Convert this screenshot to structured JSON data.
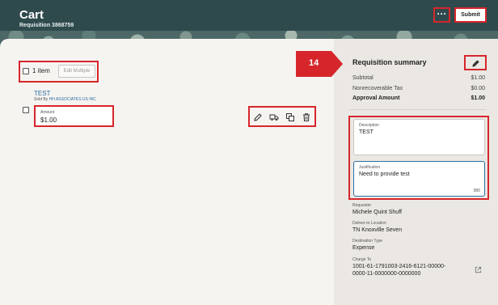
{
  "header": {
    "title": "Cart",
    "requisition": "Requisition 3868759",
    "more_label": "···",
    "submit_label": "Submit"
  },
  "selection": {
    "item_count": "1 item",
    "edit_multiple_label": "Edit Multiple"
  },
  "line_item": {
    "name": "TEST",
    "sold_by_prefix": "Sold By",
    "supplier": "HH ASSOCIATES US INC",
    "amount_label": "Amount",
    "amount_value": "$1.00",
    "actions": [
      "edit-icon",
      "truck-icon",
      "copy-icon",
      "trash-icon"
    ]
  },
  "callout": {
    "number": "14",
    "color": "#d6262c"
  },
  "summary": {
    "title": "Requisition summary",
    "rows": [
      {
        "label": "Subtotal",
        "value": "$1.00"
      },
      {
        "label": "Nonrecoverable Tax",
        "value": "$0.00"
      },
      {
        "label": "Approval Amount",
        "value": "$1.00"
      }
    ],
    "description_label": "Description",
    "description_value": "TEST",
    "justification_label": "Justification",
    "justification_value": "Need to provide test",
    "justification_counter": "980",
    "requester_label": "Requester",
    "requester_value": "Michele Quint Shuff",
    "deliver_label": "Deliver-to Location",
    "deliver_value": "TN Knoxville Seven",
    "destination_label": "Destination Type",
    "destination_value": "Expense",
    "charge_label": "Charge To",
    "charge_line1": "1001-61-1791003-2416-6121-00000-",
    "charge_line2": "0000-11-0000000-0000000"
  },
  "colors": {
    "header_bg": "#2f4a4d",
    "annotation_red": "#d6262c",
    "link_blue": "#2c6fa3"
  }
}
